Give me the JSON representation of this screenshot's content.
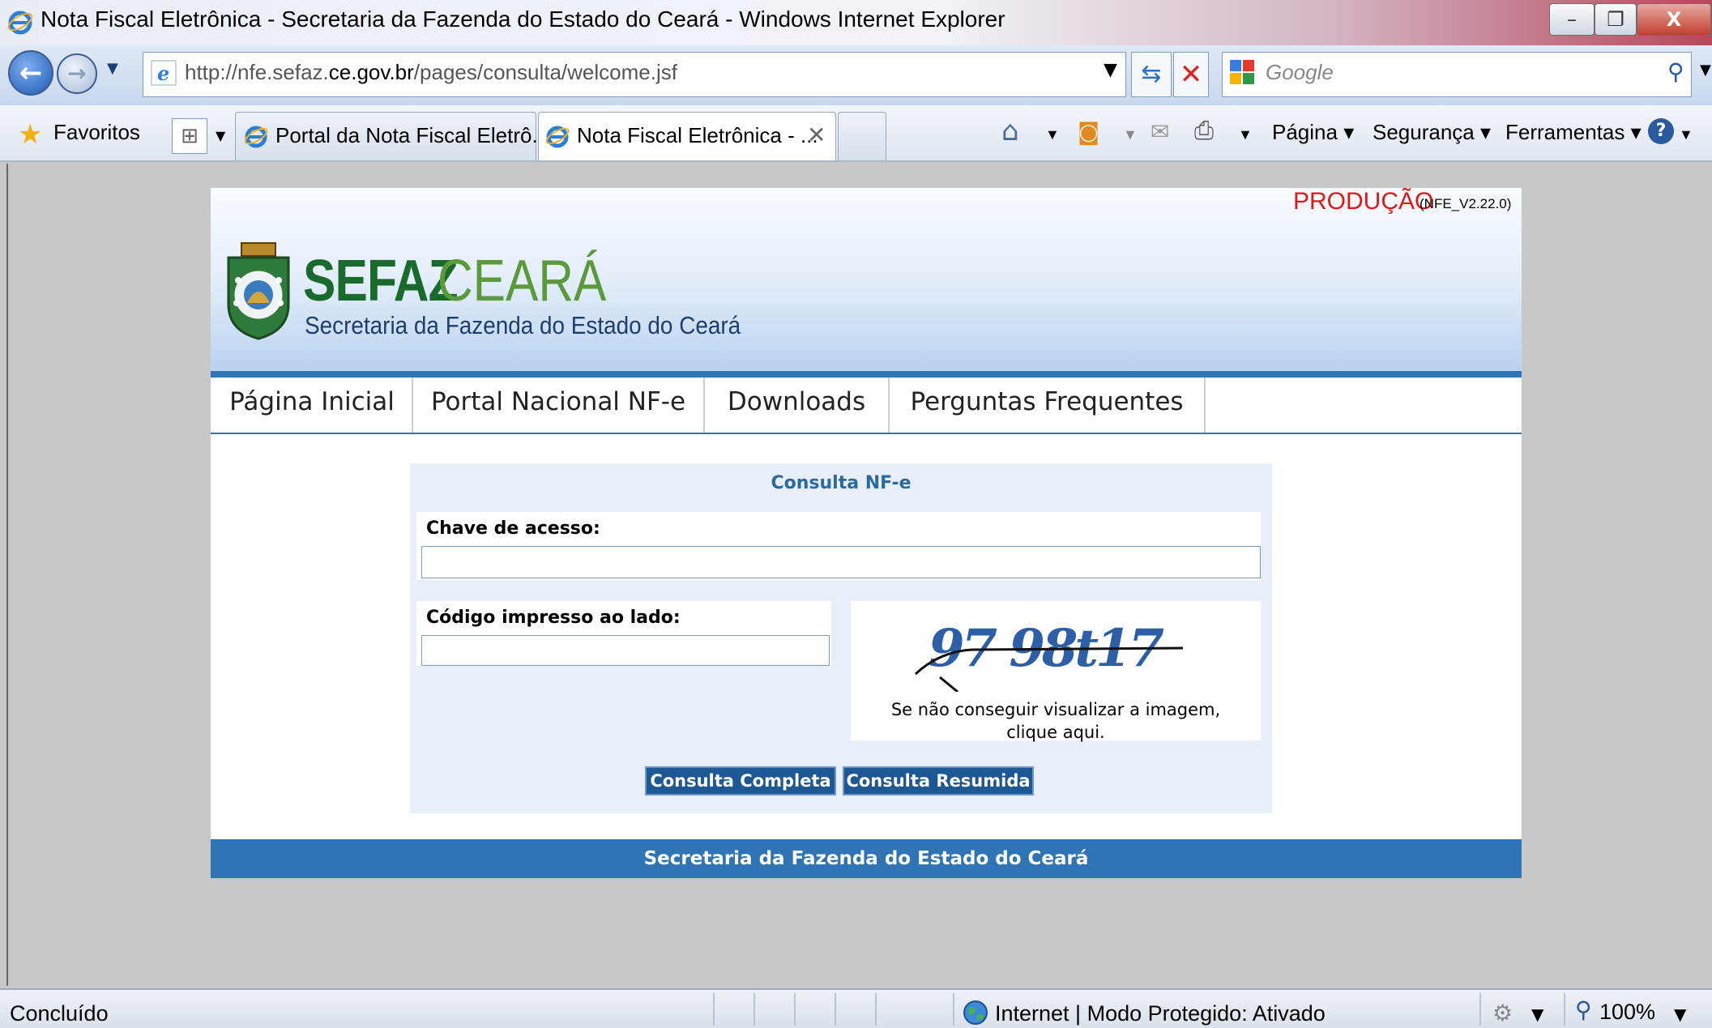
{
  "window": {
    "title": "Nota Fiscal Eletrônica - Secretaria da Fazenda do Estado do Ceará - Windows Internet Explorer",
    "minimize": "–",
    "maximize": "❐",
    "close": "X"
  },
  "address_bar": {
    "url_prefix": "http://nfe.sefaz.",
    "url_domain": "ce.gov.br",
    "url_suffix": "/pages/consulta/welcome.jsf",
    "search_placeholder": "Google"
  },
  "tab_bar": {
    "favorites_label": "Favoritos",
    "tabs": [
      {
        "label": "Portal da Nota Fiscal Eletrô..."
      },
      {
        "label": "Nota Fiscal Eletrônica - ..."
      }
    ],
    "commands": {
      "pagina": "Página",
      "seguranca": "Segurança",
      "ferramentas": "Ferramentas"
    }
  },
  "header": {
    "environment": "PRODUÇÃO",
    "version": "(NFE_V2.22.0)",
    "logo_bold": "SEFAZ",
    "logo_light": "CEARÁ",
    "logo_subtitle": "Secretaria da Fazenda do Estado do Ceará"
  },
  "menu": {
    "items": [
      {
        "label": "Página Inicial"
      },
      {
        "label": "Portal Nacional NF-e"
      },
      {
        "label": "Downloads"
      },
      {
        "label": "Perguntas Frequentes"
      }
    ]
  },
  "form": {
    "title": "Consulta NF-e",
    "chave_label": "Chave de acesso:",
    "chave_value": "",
    "codigo_label": "Código impresso ao lado:",
    "codigo_value": "",
    "captcha_text": "97 98t17",
    "captcha_help_1": "Se não conseguir visualizar a imagem,",
    "captcha_help_2": "clique aqui.",
    "btn_completa": "Consulta Completa",
    "btn_resumida": "Consulta Resumida"
  },
  "footer": {
    "text": "Secretaria da Fazenda do Estado do Ceará"
  },
  "status_bar": {
    "status": "Concluído",
    "zone": "Internet | Modo Protegido: Ativado",
    "zoom": "100%"
  },
  "colors": {
    "header_blue": "#2f74b5",
    "button_blue": "#1d5794",
    "producao_red": "#e01818",
    "sefaz_green": "#1a6a2e"
  }
}
